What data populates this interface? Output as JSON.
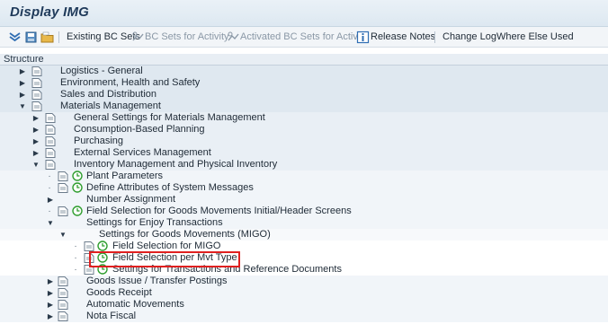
{
  "window": {
    "title": "Display IMG"
  },
  "toolbar": {
    "existing_bc_sets": "Existing BC Sets",
    "bc_sets_for_activity": "BC Sets for Activity",
    "activated_bc_sets_for_activity": "Activated BC Sets for Activity",
    "release_notes": "Release Notes",
    "change_log": "Change Log",
    "where_else_used": "Where Else Used"
  },
  "structure_header": "Structure",
  "tree": [
    {
      "label": "Logistics - General",
      "expander": "collapsed"
    },
    {
      "label": "Environment, Health and Safety",
      "expander": "collapsed"
    },
    {
      "label": "Sales and Distribution",
      "expander": "collapsed"
    },
    {
      "label": "Materials Management",
      "expander": "expanded"
    },
    {
      "label": "General Settings for Materials Management",
      "expander": "collapsed"
    },
    {
      "label": "Consumption-Based Planning",
      "expander": "collapsed"
    },
    {
      "label": "Purchasing",
      "expander": "collapsed"
    },
    {
      "label": "External Services Management",
      "expander": "collapsed"
    },
    {
      "label": "Inventory Management and Physical Inventory",
      "expander": "expanded"
    },
    {
      "label": "Plant Parameters",
      "expander": "leaf"
    },
    {
      "label": "Define Attributes of System Messages",
      "expander": "leaf"
    },
    {
      "label": "Number Assignment",
      "expander": "collapsed"
    },
    {
      "label": "Field Selection for Goods Movements Initial/Header Screens",
      "expander": "leaf"
    },
    {
      "label": "Settings for Enjoy Transactions",
      "expander": "expanded"
    },
    {
      "label": "Settings for Goods Movements (MIGO)",
      "expander": "expanded"
    },
    {
      "label": "Field Selection for MIGO",
      "expander": "leaf"
    },
    {
      "label": "Field Selection per Mvt Type",
      "expander": "leaf",
      "selected": true
    },
    {
      "label": "Settings for Transactions and Reference Documents",
      "expander": "leaf"
    },
    {
      "label": "Goods Issue / Transfer Postings",
      "expander": "collapsed"
    },
    {
      "label": "Goods Receipt",
      "expander": "collapsed"
    },
    {
      "label": "Automatic Movements",
      "expander": "collapsed"
    },
    {
      "label": "Nota Fiscal",
      "expander": "collapsed"
    }
  ],
  "colors": {
    "highlight": "#e02020",
    "exec_icon": "#2f9e2f",
    "title": "#1f3a5a"
  }
}
